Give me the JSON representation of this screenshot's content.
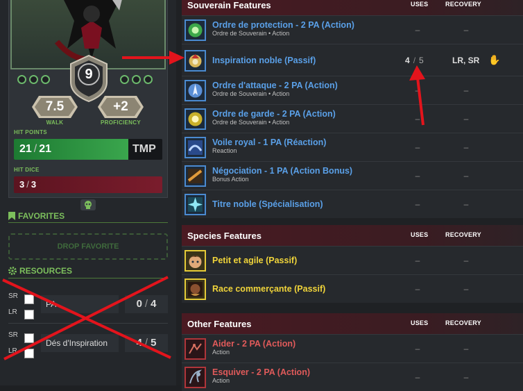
{
  "character": {
    "level": "9",
    "walk": {
      "value": "7.5",
      "label": "WALK"
    },
    "proficiency": {
      "value": "+2",
      "label": "PROFICIENCY"
    },
    "hit_points": {
      "label": "HIT POINTS",
      "current": "21",
      "max": "21",
      "tmp_label": "TMP"
    },
    "hit_dice": {
      "label": "HIT DICE",
      "current": "3",
      "max": "3"
    }
  },
  "favorites": {
    "heading": "FAVORITES",
    "drop_label": "DROP FAVORITE"
  },
  "resources": {
    "heading": "RESOURCES",
    "items": [
      {
        "sr": "SR",
        "lr": "LR",
        "name": "PA",
        "current": "0",
        "max": "4"
      },
      {
        "sr": "SR",
        "lr": "LR",
        "name": "Dés d'Inspiration",
        "current": "4",
        "max": "5"
      }
    ]
  },
  "columns": {
    "uses": "USES",
    "recovery": "RECOVERY"
  },
  "sections": {
    "souverain": {
      "title": "Souverain Features",
      "items": [
        {
          "name": "Ordre de protection - 2 PA (Action)",
          "sub": "Ordre de Souverain • Action",
          "uses": "–",
          "recovery": "–",
          "icon": "protection-icon"
        },
        {
          "name": "Inspiration noble (Passif)",
          "sub": "",
          "uses_current": "4",
          "uses_max": "5",
          "recovery": "LR, SR",
          "icon": "noble-icon"
        },
        {
          "name": "Ordre d'attaque - 2 PA (Action)",
          "sub": "Ordre de Souverain • Action",
          "uses": "–",
          "recovery": "–",
          "icon": "attack-icon"
        },
        {
          "name": "Ordre de garde - 2 PA (Action)",
          "sub": "Ordre de Souverain • Action",
          "uses": "–",
          "recovery": "–",
          "icon": "guard-icon"
        },
        {
          "name": "Voile royal - 1 PA (Réaction)",
          "sub": "Reaction",
          "uses": "–",
          "recovery": "–",
          "icon": "veil-icon"
        },
        {
          "name": "Négociation - 1 PA (Action Bonus)",
          "sub": "Bonus Action",
          "uses": "–",
          "recovery": "–",
          "icon": "negotiation-icon"
        },
        {
          "name": "Titre noble (Spécialisation)",
          "sub": "",
          "uses": "–",
          "recovery": "–",
          "icon": "title-icon"
        }
      ]
    },
    "species": {
      "title": "Species Features",
      "items": [
        {
          "name": "Petit et agile (Passif)",
          "uses": "–",
          "recovery": "–",
          "icon": "halfling-icon"
        },
        {
          "name": "Race commerçante (Passif)",
          "uses": "–",
          "recovery": "–",
          "icon": "merchant-icon"
        }
      ]
    },
    "other": {
      "title": "Other Features",
      "items": [
        {
          "name": "Aider - 2 PA (Action)",
          "sub": "Action",
          "uses": "–",
          "recovery": "–",
          "icon": "help-icon"
        },
        {
          "name": "Esquiver - 2 PA (Action)",
          "sub": "Action",
          "uses": "–",
          "recovery": "–",
          "icon": "dodge-icon"
        }
      ]
    }
  },
  "colors": {
    "accent_green": "#7cbf5c",
    "link_blue": "#5aa0e8",
    "species_yellow": "#f0d43a",
    "other_red": "#e05a5a",
    "annotation_red": "#e3141c"
  }
}
